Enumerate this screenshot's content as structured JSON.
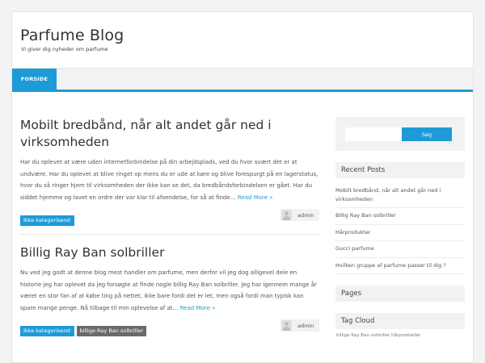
{
  "site": {
    "title": "Parfume Blog",
    "tagline": "Vi giver dig nyheder om parfume"
  },
  "nav": {
    "items": [
      {
        "label": "FORSIDE"
      }
    ]
  },
  "posts": [
    {
      "title": "Mobilt bredbånd, når alt andet går ned i virksomheden",
      "excerpt": "Har du oplevet at være uden internetforbindelse på din arbejdsplads, ved du hvor svært det er at undvære. Har du oplevet at blive ringet op mens du er ude at køre og blive forespurgt på en lagerstatus, hvor du så ringer hjem til virksomheden der ikke kan se det, da bredbåndsforbindelsen er gået. Har du siddet hjemme og lavet en ordre der var klar til afsendelse, for så at finde…",
      "read_more": "Read More »",
      "tags": [
        "Ikke kategoriseret"
      ],
      "author": "admin"
    },
    {
      "title": "Billig Ray Ban solbriller",
      "excerpt": "Nu ved jeg godt at denne blog mest handler om parfume, men derfor vil jeg dog alligevel dele en historie jeg har oplevet da jeg forsøgte at finde nogle billig Ray Ban solbriller. Jeg har igennem mange år været en stor fan af at købe ting på nettet, ikke bare fordi det er let, men også fordi man typisk kan spare mange penge. Nå tilbage til min oplevelse af at…",
      "read_more": "Read More »",
      "tags": [
        "Ikke kategoriseret",
        "billige Ray Ban solbriller"
      ],
      "author": "admin"
    }
  ],
  "sidebar": {
    "search": {
      "button": "Søg",
      "value": ""
    },
    "recent_posts": {
      "title": "Recent Posts",
      "items": [
        "Mobilt bredbånd, når alt andet går ned i virksomheden",
        "Billig Ray Ban solbriller",
        "Hårprodukter",
        "Gucci parfume",
        "Hvilken gruppe af parfume passer til dig ?"
      ]
    },
    "pages": {
      "title": "Pages"
    },
    "tag_cloud": {
      "title": "Tag Cloud",
      "items": [
        "billige Ray Ban solbriller",
        "hårprodukter"
      ]
    }
  },
  "colors": {
    "accent": "#1e9bd7",
    "tag_dark": "#6b6b6b",
    "panel": "#f2f2f2"
  }
}
